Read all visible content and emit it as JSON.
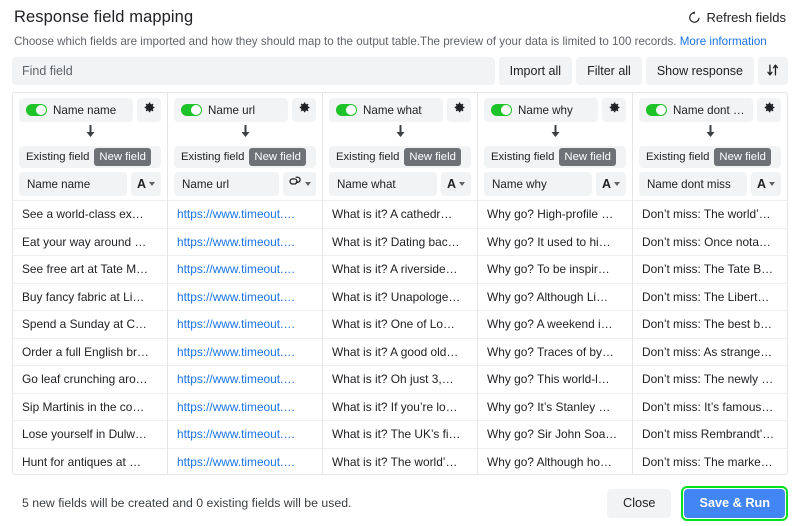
{
  "header": {
    "title": "Response field mapping",
    "refresh_label": "Refresh fields",
    "refresh_icon": "refresh-icon",
    "subtitle": "Choose which fields are imported and how they should map to the output table.The preview of your data is limited to 100 records.",
    "subtitle_link": "More information"
  },
  "toolbar": {
    "find_placeholder": "Find field",
    "import_all": "Import all",
    "filter_all": "Filter all",
    "show_response": "Show response",
    "sort_icon": "sort-icon"
  },
  "mapping": {
    "existing_label": "Existing field",
    "new_label": "New field",
    "arrow_icon": "arrow-down-icon",
    "gear_icon": "gear-icon",
    "toggle_icon": "toggle-on-icon",
    "caret_icon": "chevron-down-icon"
  },
  "colors": {
    "toggle_on": "#1ec229",
    "link": "#1a73e8",
    "primary": "#4285f4",
    "highlight": "#00e021",
    "chip_bg": "#f1f3f4",
    "active_seg": "#6e7277"
  },
  "columns": [
    {
      "toggle_label": "Name name",
      "field_name": "Name name",
      "type_glyph": "A",
      "type_icon": "text-type-icon",
      "mapping_mode": "New field",
      "link": false
    },
    {
      "toggle_label": "Name url",
      "field_name": "Name url",
      "type_glyph": "⭯",
      "type_icon": "url-type-icon",
      "mapping_mode": "New field",
      "link": true
    },
    {
      "toggle_label": "Name what",
      "field_name": "Name what",
      "type_glyph": "A",
      "type_icon": "text-type-icon",
      "mapping_mode": "New field",
      "link": false
    },
    {
      "toggle_label": "Name why",
      "field_name": "Name why",
      "type_glyph": "A",
      "type_icon": "text-type-icon",
      "mapping_mode": "New field",
      "link": false
    },
    {
      "toggle_label": "Name dont mi...",
      "field_name": "Name dont miss",
      "type_glyph": "A",
      "type_icon": "text-type-icon",
      "mapping_mode": "New field",
      "link": false
    }
  ],
  "rows": [
    [
      "See a world-class ex…",
      "https://www.timeout.…",
      "What is it? A cathedr…",
      "Why go? High-profile …",
      "Don’t miss: The world’…"
    ],
    [
      "Eat your way around …",
      "https://www.timeout.…",
      "What is it? Dating bac…",
      "Why go? It used to hi…",
      "Don’t miss: Once nota…"
    ],
    [
      "See free art at Tate M…",
      "https://www.timeout.…",
      "What is it? A riverside…",
      "Why go? To be inspir…",
      "Don’t miss: The Tate B…"
    ],
    [
      "Buy fancy fabric at Li…",
      "https://www.timeout.…",
      "What is it? Unapologe…",
      "Why go? Although Li…",
      "Don’t miss: The Libert…"
    ],
    [
      "Spend a Sunday at C…",
      "https://www.timeout.…",
      "What is it? One of Lo…",
      "Why go? A weekend i…",
      "Don’t miss: The best b…"
    ],
    [
      "Order a full English br…",
      "https://www.timeout.…",
      "What is it? A good old…",
      "Why go? Traces of by…",
      "Don’t miss: As strange…"
    ],
    [
      "Go leaf crunching aro…",
      "https://www.timeout.…",
      "What is it? Oh just 3,…",
      "Why go? This world-l…",
      "Don’t miss: The newly …"
    ],
    [
      "Sip Martinis in the co…",
      "https://www.timeout.…",
      "What is it? If you’re lo…",
      "Why go? It’s Stanley …",
      "Don’t miss: It’s famous…"
    ],
    [
      "Lose yourself in Dulw…",
      "https://www.timeout.…",
      "What is it? The UK’s fi…",
      "Why go? Sir John Soa…",
      "Don’t miss Rembrandt’…"
    ],
    [
      "Hunt for antiques at …",
      "https://www.timeout.…",
      "What is it? The world’…",
      "Why go? Although ho…",
      "Don’t miss: The marke…"
    ]
  ],
  "footer": {
    "note": "5 new fields will be created and 0 existing fields will be used.",
    "close_label": "Close",
    "save_label": "Save & Run"
  }
}
